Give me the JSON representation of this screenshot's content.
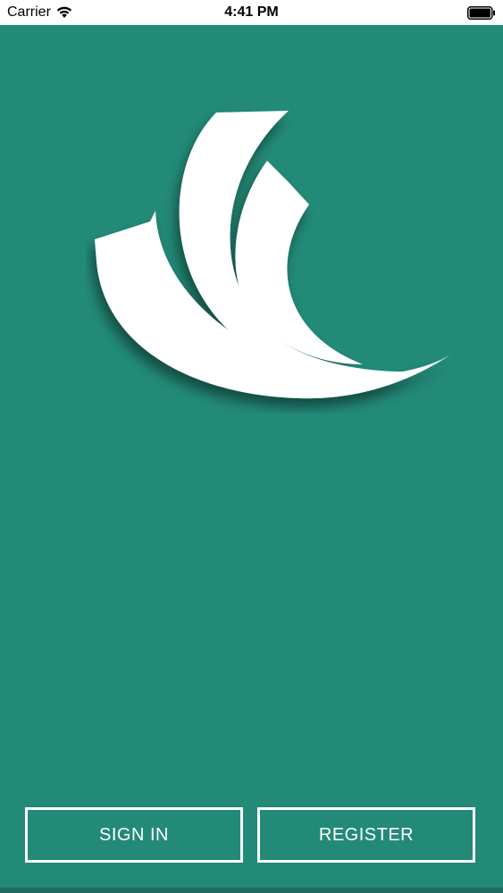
{
  "status_bar": {
    "carrier": "Carrier",
    "time": "4:41 PM",
    "icons": [
      "wifi-icon",
      "battery-icon"
    ]
  },
  "logo": {
    "icon": "book-pages-logo-icon",
    "color": "#ffffff"
  },
  "buttons": {
    "sign_in_label": "SIGN IN",
    "register_label": "REGISTER"
  },
  "colors": {
    "background": "#238a78",
    "button_border": "#ffffff",
    "status_bar_bg": "#ffffff"
  }
}
